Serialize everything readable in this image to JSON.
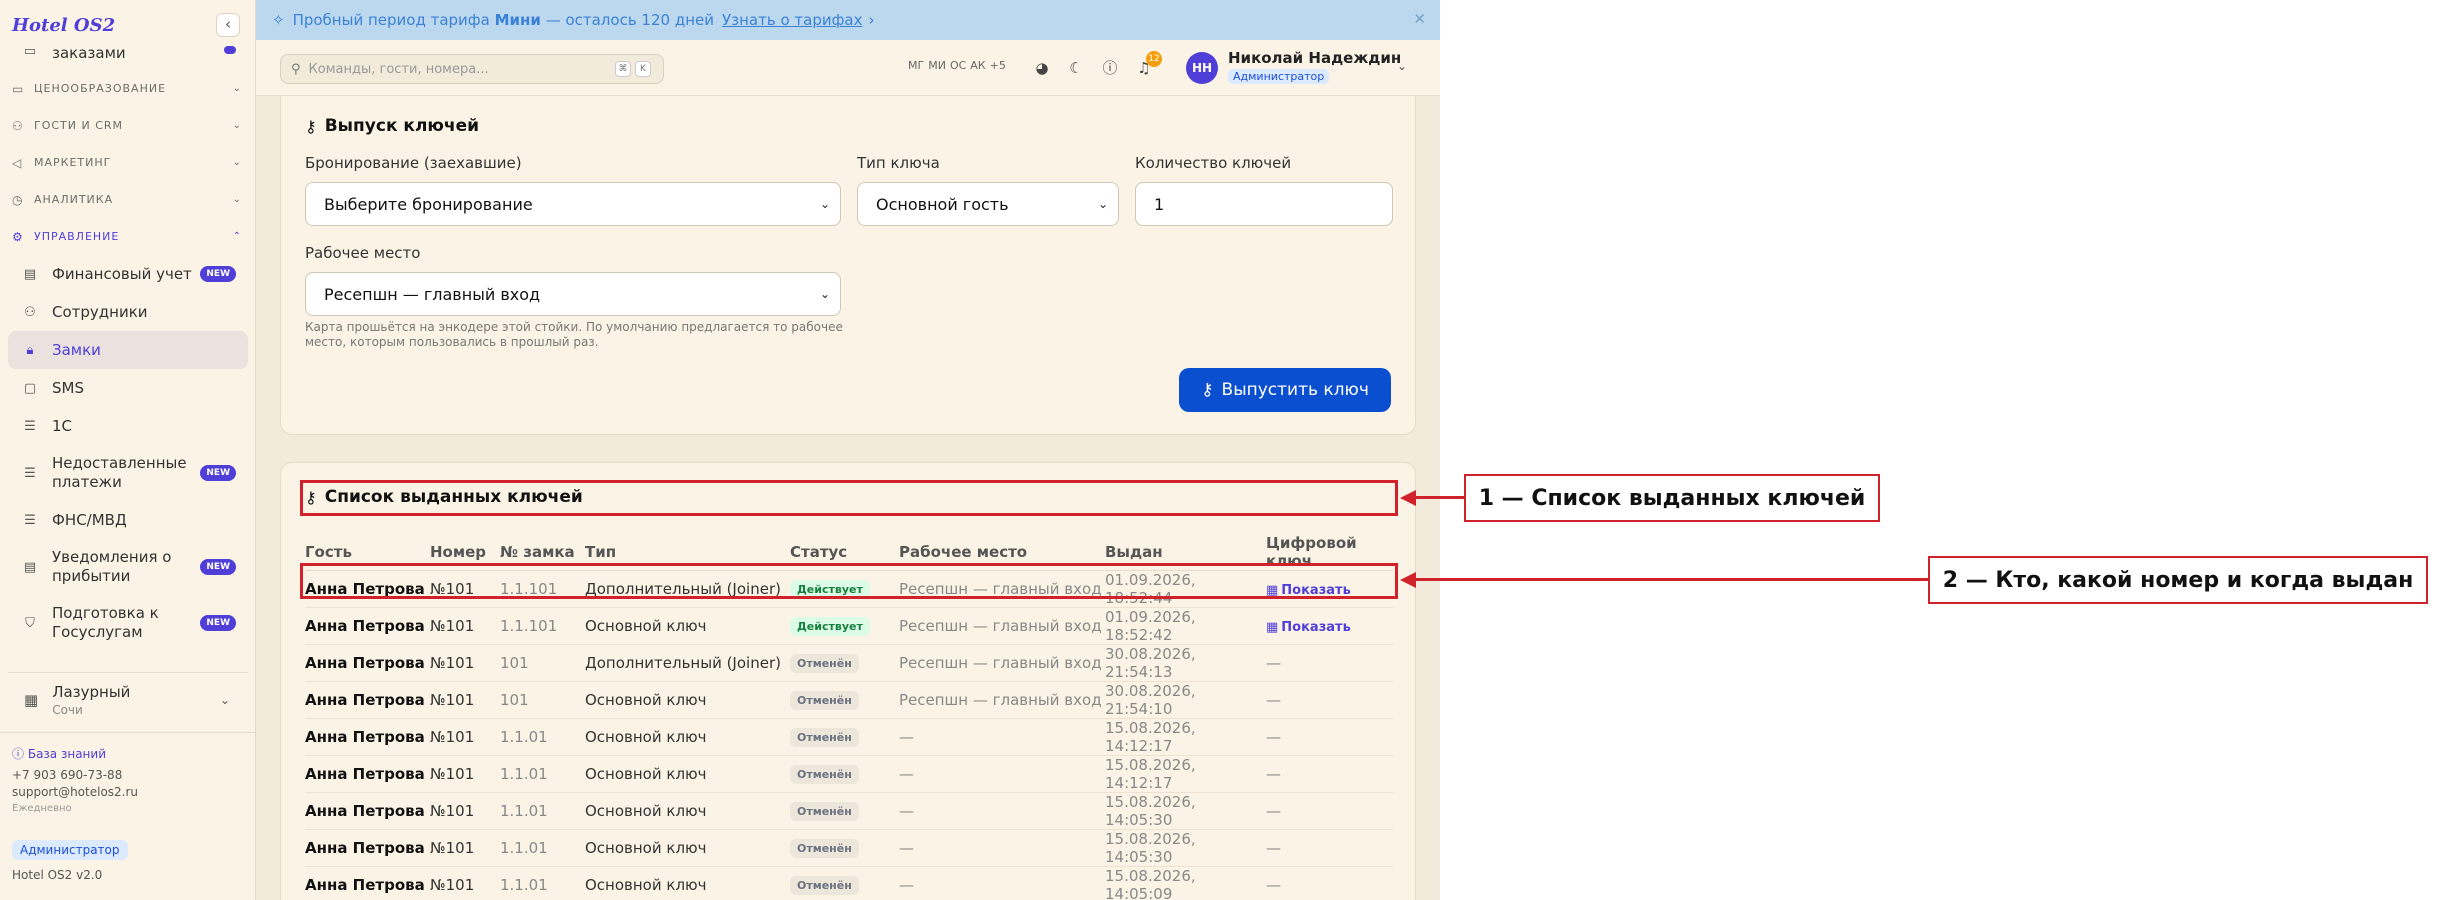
{
  "sidebar": {
    "logo": "Hotel OS2",
    "collapse_icon": "chevron-left-icon",
    "item_partial": "заказами",
    "sections": [
      "ЦЕНООБРАЗОВАНИЕ",
      "ГОСТИ И CRM",
      "МАРКЕТИНГ",
      "АНАЛИТИКА",
      "УПРАВЛЕНИЕ"
    ],
    "items": [
      {
        "label": "Финансовый учет",
        "badge": "NEW",
        "icon": "wallet-icon"
      },
      {
        "label": "Сотрудники",
        "badge": "",
        "icon": "user-icon"
      },
      {
        "label": "Замки",
        "badge": "",
        "icon": "lock-icon",
        "active": true
      },
      {
        "label": "SMS",
        "badge": "",
        "icon": "message-icon"
      },
      {
        "label": "1С",
        "badge": "",
        "icon": "database-icon"
      },
      {
        "label": "Недоставленные платежи",
        "badge": "NEW",
        "icon": "database-icon"
      },
      {
        "label": "ФНС/МВД",
        "badge": "",
        "icon": "database-icon"
      },
      {
        "label": "Уведомления о прибытии",
        "badge": "NEW",
        "icon": "document-icon"
      },
      {
        "label": "Подготовка к Госуслугам",
        "badge": "NEW",
        "icon": "shield-icon"
      }
    ],
    "hotel": {
      "name": "Лазурный",
      "city": "Сочи"
    },
    "footer": {
      "kb": "База знаний",
      "phone": "+7 903 690-73-88",
      "email": "support@hotelos2.ru",
      "schedule": "Ежедневно",
      "role": "Администратор",
      "version": "Hotel OS2 v2.0"
    }
  },
  "banner": {
    "prefix": "Пробный период тарифа",
    "plan": "Мини",
    "suffix": "— осталось 120 дней",
    "link": "Узнать о тарифах"
  },
  "topbar": {
    "search_placeholder": "Команды, гости, номера...",
    "kbd1": "⌘",
    "kbd2": "K",
    "avatars": [
      "МГ",
      "МИ",
      "ОС",
      "АК",
      "+5"
    ],
    "notif_count": "12",
    "user": {
      "initials": "НН",
      "name": "Николай Надеждин",
      "role": "Администратор"
    }
  },
  "issue": {
    "title": "Выпуск ключей",
    "booking_label": "Бронирование (заехавшие)",
    "booking_value": "Выберите бронирование",
    "type_label": "Тип ключа",
    "type_value": "Основной гость",
    "count_label": "Количество ключей",
    "count_value": "1",
    "workplace_label": "Рабочее место",
    "workplace_value": "Ресепшн — главный вход",
    "hint": "Карта прошьётся на энкодере этой стойки. По умолчанию предлагается то рабочее место, которым пользовались в прошлый раз.",
    "button": "Выпустить ключ"
  },
  "keys": {
    "title": "Список выданных ключей",
    "columns": [
      "Гость",
      "Номер",
      "№ замка",
      "Тип",
      "Статус",
      "Рабочее место",
      "Выдан",
      "Цифровой ключ"
    ],
    "rows": [
      {
        "guest": "Анна Петрова",
        "room": "№101",
        "lock": "1.1.101",
        "type": "Дополнительный (Joiner)",
        "status": "Действует",
        "workplace": "Ресепшн — главный вход",
        "issued": "01.09.2026, 18:52:44",
        "digital": "Показать"
      },
      {
        "guest": "Анна Петрова",
        "room": "№101",
        "lock": "1.1.101",
        "type": "Основной ключ",
        "status": "Действует",
        "workplace": "Ресепшн — главный вход",
        "issued": "01.09.2026, 18:52:42",
        "digital": "Показать"
      },
      {
        "guest": "Анна Петрова",
        "room": "№101",
        "lock": "101",
        "type": "Дополнительный (Joiner)",
        "status": "Отменён",
        "workplace": "Ресепшн — главный вход",
        "issued": "30.08.2026, 21:54:13",
        "digital": "—"
      },
      {
        "guest": "Анна Петрова",
        "room": "№101",
        "lock": "101",
        "type": "Основной ключ",
        "status": "Отменён",
        "workplace": "Ресепшн — главный вход",
        "issued": "30.08.2026, 21:54:10",
        "digital": "—"
      },
      {
        "guest": "Анна Петрова",
        "room": "№101",
        "lock": "1.1.01",
        "type": "Основной ключ",
        "status": "Отменён",
        "workplace": "—",
        "issued": "15.08.2026, 14:12:17",
        "digital": "—"
      },
      {
        "guest": "Анна Петрова",
        "room": "№101",
        "lock": "1.1.01",
        "type": "Основной ключ",
        "status": "Отменён",
        "workplace": "—",
        "issued": "15.08.2026, 14:12:17",
        "digital": "—"
      },
      {
        "guest": "Анна Петрова",
        "room": "№101",
        "lock": "1.1.01",
        "type": "Основной ключ",
        "status": "Отменён",
        "workplace": "—",
        "issued": "15.08.2026, 14:05:30",
        "digital": "—"
      },
      {
        "guest": "Анна Петрова",
        "room": "№101",
        "lock": "1.1.01",
        "type": "Основной ключ",
        "status": "Отменён",
        "workplace": "—",
        "issued": "15.08.2026, 14:05:30",
        "digital": "—"
      },
      {
        "guest": "Анна Петрова",
        "room": "№101",
        "lock": "1.1.01",
        "type": "Основной ключ",
        "status": "Отменён",
        "workplace": "—",
        "issued": "15.08.2026, 14:05:09",
        "digital": "—"
      }
    ]
  },
  "annotations": {
    "a1": "1 — Список выданных ключей",
    "a2": "2 — Кто, какой номер и когда выдан"
  },
  "colors": {
    "accent": "#4f3fd8",
    "primary_button": "#0b4fd1",
    "annotation": "#d0222a",
    "active": "#15803d"
  }
}
